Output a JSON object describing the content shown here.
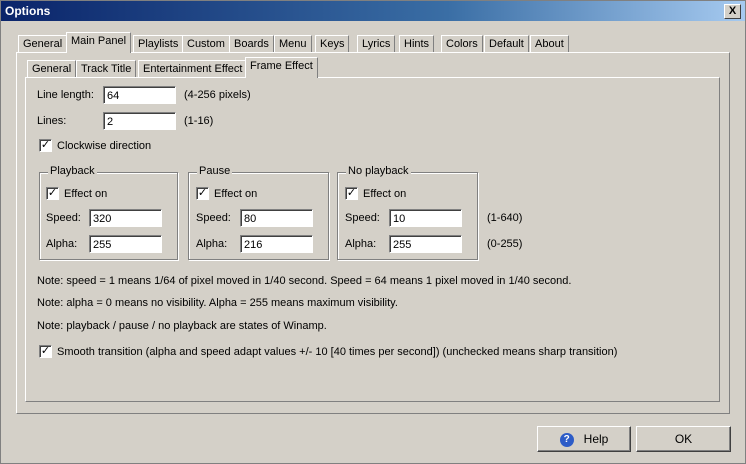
{
  "window": {
    "title": "Options",
    "close_glyph": "X"
  },
  "main_tabs": [
    "General",
    "Main Panel",
    "Playlists",
    "Custom",
    "Boards",
    "Menu",
    "Keys",
    "Lyrics",
    "Hints",
    "Colors",
    "Default",
    "About"
  ],
  "sub_tabs": [
    "General",
    "Track Title",
    "Entertainment Effect",
    "Frame Effect"
  ],
  "form": {
    "line_length_label": "Line length:",
    "line_length_value": "64",
    "line_length_hint": "(4-256 pixels)",
    "lines_label": "Lines:",
    "lines_value": "2",
    "lines_hint": "(1-16)",
    "clockwise_label": "Clockwise direction",
    "clockwise_check": "✓"
  },
  "groups": {
    "playback": {
      "title": "Playback",
      "effect_label": "Effect on",
      "speed_label": "Speed:",
      "speed": "320",
      "alpha_label": "Alpha:",
      "alpha": "255"
    },
    "pause": {
      "title": "Pause",
      "effect_label": "Effect on",
      "speed_label": "Speed:",
      "speed": "80",
      "alpha_label": "Alpha:",
      "alpha": "216"
    },
    "no_playback": {
      "title": "No playback",
      "effect_label": "Effect on",
      "speed_label": "Speed:",
      "speed": "10",
      "alpha_label": "Alpha:",
      "alpha": "255"
    },
    "check": "✓"
  },
  "ranges": {
    "speed": "(1-640)",
    "alpha": "(0-255)"
  },
  "notes": [
    "Note:  speed = 1 means 1/64 of pixel moved in 1/40 second. Speed = 64 means 1 pixel moved in 1/40 second.",
    "Note:  alpha = 0 means no visibility. Alpha = 255 means maximum visibility.",
    "Note:  playback / pause / no playback are states of Winamp."
  ],
  "smooth": {
    "label": "Smooth transition (alpha and speed adapt values +/- 10 [40 times per second]) (unchecked means sharp transition)",
    "check": "✓"
  },
  "buttons": {
    "help": "Help",
    "help_icon": "?",
    "ok": "OK"
  }
}
